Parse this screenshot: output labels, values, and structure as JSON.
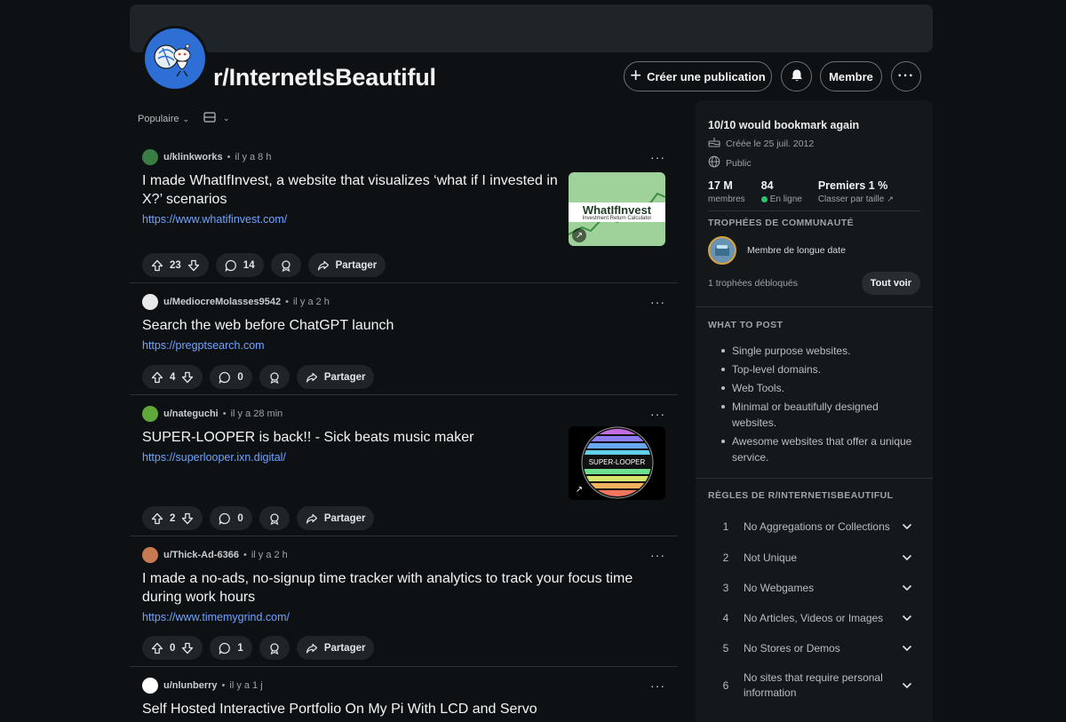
{
  "subreddit": {
    "name": "r/InternetIsBeautiful",
    "avatar_icon": "reddit-snoo-icon"
  },
  "header": {
    "create_post_label": "Créer une publication",
    "member_label": "Membre",
    "more_label": "···"
  },
  "sort": {
    "label": "Populaire"
  },
  "posts": [
    {
      "user": "u/klinkworks",
      "time": "il y a 8 h",
      "title": "I made WhatIfInvest, a website that visualizes ‘what if I invested in X?’ scenarios",
      "link": "https://www.whatifinvest.com/",
      "votes": "23",
      "comments": "14",
      "share_label": "Partager",
      "thumb": {
        "heading": "WhatIfInvest",
        "sub": "Investment Return Calculator"
      }
    },
    {
      "user": "u/MediocreMolasses9542",
      "time": "il y a 2 h",
      "title": "Search the web before ChatGPT launch",
      "link": "https://pregptsearch.com",
      "votes": "4",
      "comments": "0",
      "share_label": "Partager"
    },
    {
      "user": "u/nateguchi",
      "time": "il y a 28 min",
      "title": "SUPER-LOOPER is back!! - Sick beats music maker",
      "link": "https://superlooper.ixn.digital/",
      "votes": "2",
      "comments": "0",
      "share_label": "Partager",
      "thumb": {
        "heading": "SUPER-LOOPER"
      }
    },
    {
      "user": "u/Thick-Ad-6366",
      "time": "il y a 2 h",
      "title": "I made a no-ads, no-signup time tracker with analytics to track your focus time during work hours",
      "link": "https://www.timemygrind.com/",
      "votes": "0",
      "comments": "1",
      "share_label": "Partager"
    },
    {
      "user": "u/nlunberry",
      "time": "il y a 1 j",
      "title": "Self Hosted Interactive Portfolio On My Pi With LCD and Servo"
    }
  ],
  "sidebar": {
    "tagline": "10/10 would bookmark again",
    "created": "Créée le 25 juil. 2012",
    "visibility": "Public",
    "stats": [
      {
        "value": "17 M",
        "label": "membres"
      },
      {
        "value": "84",
        "label": "En ligne"
      },
      {
        "value": "Premiers 1 %",
        "label": "Classer par taille"
      }
    ],
    "trophies_heading": "TROPHÉES DE COMMUNAUTÉ",
    "trophy_name": "Membre de longue date",
    "trophies_count": "1 trophées débloqués",
    "see_all_label": "Tout voir",
    "what_to_post_heading": "WHAT TO POST",
    "what_to_post": [
      "Single purpose websites.",
      "Top-level domains.",
      "Web Tools.",
      "Minimal or beautifully designed websites.",
      "Awesome websites that offer a unique service."
    ],
    "rules_heading": "RÈGLES DE R/INTERNETISBEAUTIFUL",
    "rules": [
      {
        "num": "1",
        "text": "No Aggregations or Collections"
      },
      {
        "num": "2",
        "text": "Not Unique"
      },
      {
        "num": "3",
        "text": "No Webgames"
      },
      {
        "num": "4",
        "text": "No Articles, Videos or Images"
      },
      {
        "num": "5",
        "text": "No Stores or Demos"
      },
      {
        "num": "6",
        "text": "No sites that require personal information"
      }
    ]
  },
  "colors": {
    "background": "#0e1113",
    "link": "#6fa3ff",
    "online": "#2cc36b"
  }
}
